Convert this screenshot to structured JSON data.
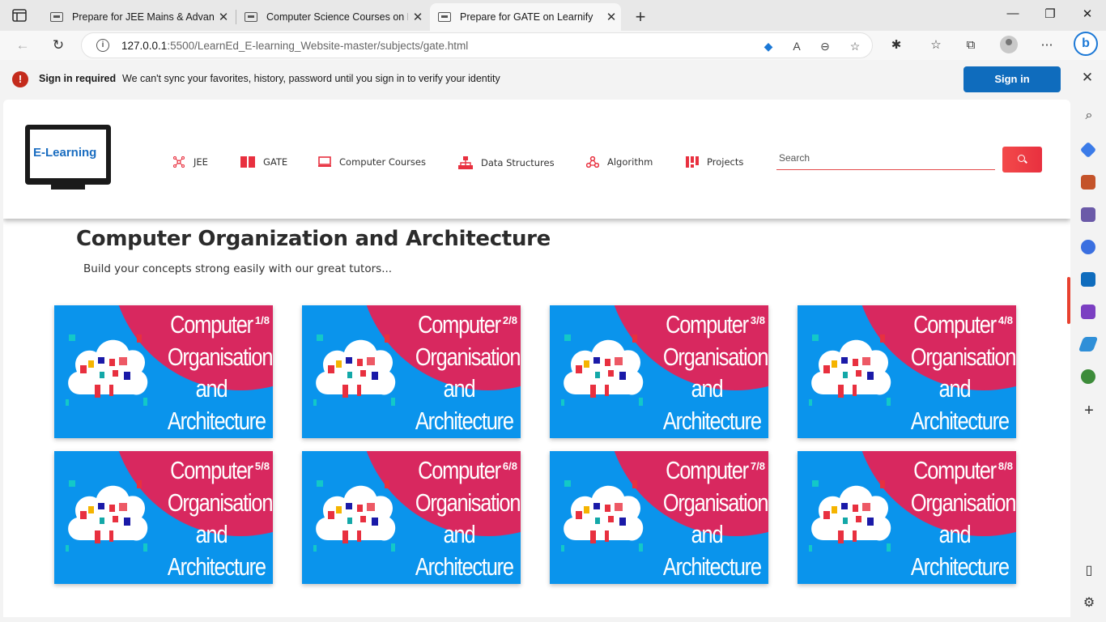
{
  "browser": {
    "tabs": [
      {
        "title": "Prepare for JEE Mains & Advanced",
        "active": false
      },
      {
        "title": "Computer Science Courses on Learnify",
        "active": false
      },
      {
        "title": "Prepare for GATE on Learnify",
        "active": true
      }
    ],
    "new_tab_glyph": "+",
    "window_controls": [
      "—",
      "❐",
      "✕"
    ],
    "url_host": "127.0.0.1",
    "url_rest": ":5500/LearnEd_E-learning_Website-master/subjects/gate.html"
  },
  "banner": {
    "title": "Sign in required",
    "message": "We can't sync your favorites, history, password until you sign in to verify your identity",
    "button": "Sign in"
  },
  "site": {
    "logo_text": "E-Learning",
    "nav": [
      {
        "label": "JEE",
        "icon": "atom-icon"
      },
      {
        "label": "GATE",
        "icon": "book-icon"
      },
      {
        "label": "Computer Courses",
        "icon": "laptop-icon"
      },
      {
        "label": "Data Structures",
        "icon": "sitemap-icon"
      },
      {
        "label": "Algorithm",
        "icon": "cog-network-icon"
      },
      {
        "label": "Projects",
        "icon": "chart-icon"
      }
    ],
    "search_placeholder": "Search"
  },
  "page": {
    "title": "Computer Organization and Architecture",
    "subtitle": "Build your concepts strong easily with our great tutors..."
  },
  "cards": [
    {
      "badge": "1/8",
      "line1": "Computer",
      "line2": "Organisation",
      "line3": "and",
      "line4": "Architecture"
    },
    {
      "badge": "2/8",
      "line1": "Computer",
      "line2": "Organisation",
      "line3": "and",
      "line4": "Architecture"
    },
    {
      "badge": "3/8",
      "line1": "Computer",
      "line2": "Organisation",
      "line3": "and",
      "line4": "Architecture"
    },
    {
      "badge": "4/8",
      "line1": "Computer",
      "line2": "Organisation",
      "line3": "and",
      "line4": "Architecture"
    },
    {
      "badge": "5/8",
      "line1": "Computer",
      "line2": "Organisation",
      "line3": "and",
      "line4": "Architecture"
    },
    {
      "badge": "6/8",
      "line1": "Computer",
      "line2": "Organisation",
      "line3": "and",
      "line4": "Architecture"
    },
    {
      "badge": "7/8",
      "line1": "Computer",
      "line2": "Organisation",
      "line3": "and",
      "line4": "Architecture"
    },
    {
      "badge": "8/8",
      "line1": "Computer",
      "line2": "Organisation",
      "line3": "and",
      "line4": "Architecture"
    }
  ],
  "colors": {
    "card_bg": "#0a94ec",
    "card_corner": "#d8285f",
    "accent_red": "#e8303f",
    "signin_blue": "#0f6cbd"
  }
}
